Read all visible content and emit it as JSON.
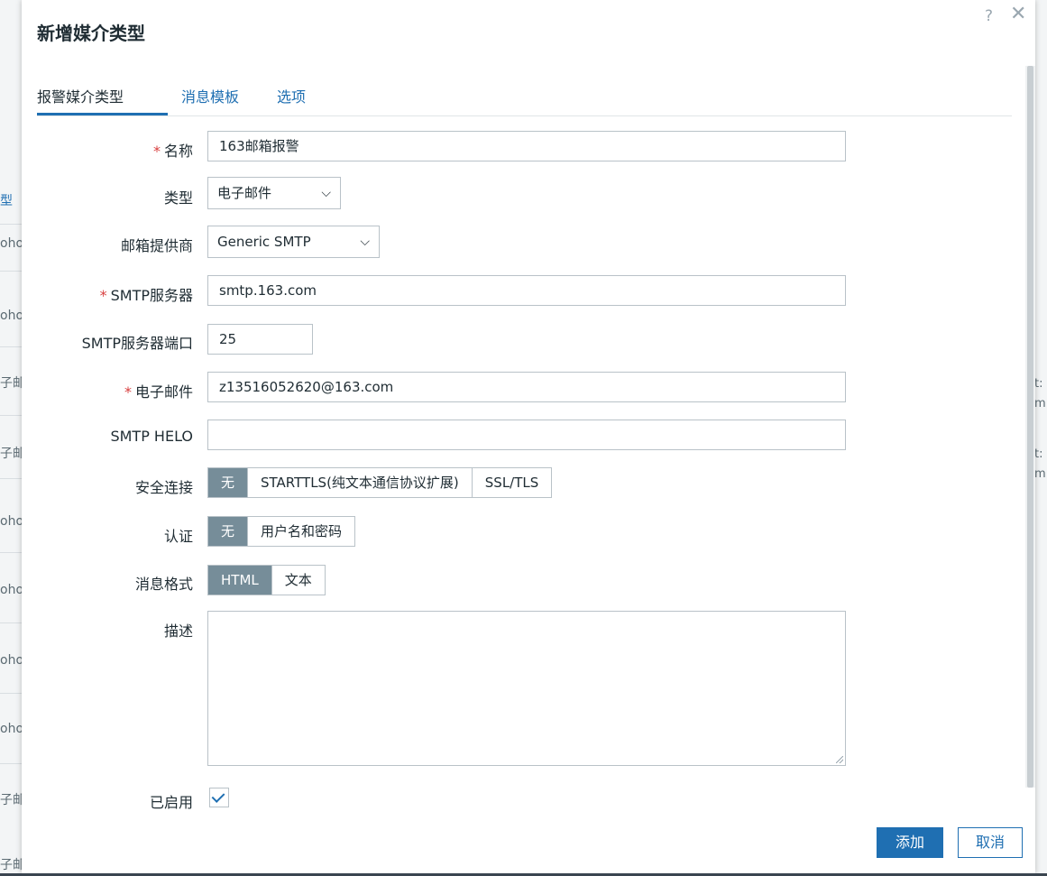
{
  "background": {
    "left_fragments": [
      "型",
      "oho",
      "oho",
      "子邮",
      "子邮",
      "oho",
      "oho",
      "oho",
      "oho",
      "子邮",
      "子邮"
    ],
    "right_fragments": [
      "t:",
      "m",
      "t:",
      "m"
    ]
  },
  "dialog": {
    "title": "新增媒介类型",
    "help_glyph": "?",
    "close_glyph": "✕"
  },
  "tabs": [
    {
      "label": "报警媒介类型",
      "active": true
    },
    {
      "label": "消息模板",
      "active": false
    },
    {
      "label": "选项",
      "active": false
    }
  ],
  "form": {
    "name": {
      "label": "名称",
      "required": "*",
      "value": "163邮箱报警"
    },
    "type": {
      "label": "类型",
      "value": "电子邮件"
    },
    "provider": {
      "label": "邮箱提供商",
      "value": "Generic SMTP"
    },
    "smtp_server": {
      "label": "SMTP服务器",
      "required": "*",
      "value": "smtp.163.com"
    },
    "smtp_port": {
      "label": "SMTP服务器端口",
      "value": "25"
    },
    "email": {
      "label": "电子邮件",
      "required": "*",
      "value": "z13516052620@163.com"
    },
    "smtp_helo": {
      "label": "SMTP HELO",
      "value": ""
    },
    "security": {
      "label": "安全连接",
      "options": [
        "无",
        "STARTTLS(纯文本通信协议扩展)",
        "SSL/TLS"
      ],
      "selected": "无"
    },
    "auth": {
      "label": "认证",
      "options": [
        "无",
        "用户名和密码"
      ],
      "selected": "无"
    },
    "format": {
      "label": "消息格式",
      "options": [
        "HTML",
        "文本"
      ],
      "selected": "HTML"
    },
    "description": {
      "label": "描述",
      "value": ""
    },
    "enabled": {
      "label": "已启用",
      "checked": true
    }
  },
  "buttons": {
    "add": "添加",
    "cancel": "取消"
  },
  "colors": {
    "accent": "#1f6fb2",
    "selected_segment": "#768d99",
    "required": "#d83f3f"
  }
}
